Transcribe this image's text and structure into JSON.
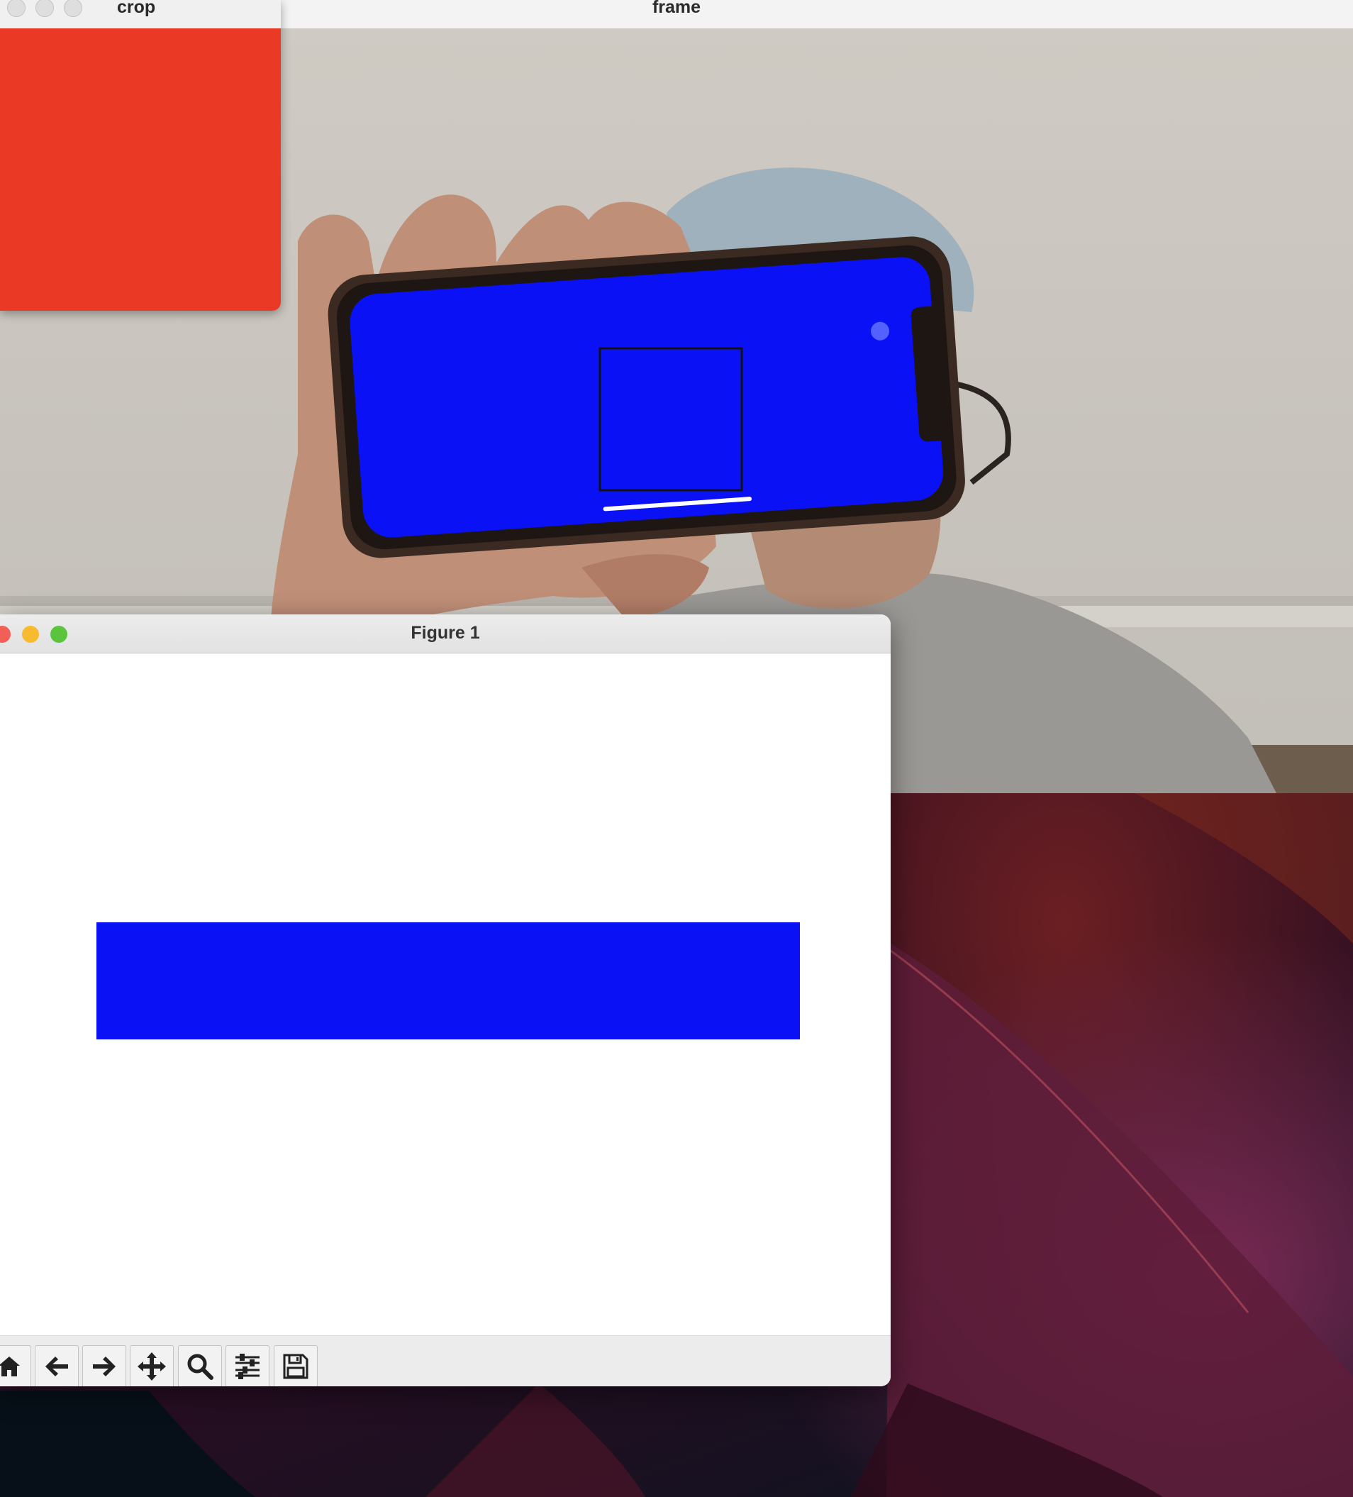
{
  "frame_window": {
    "title": "frame"
  },
  "crop_window": {
    "title": "crop",
    "fill_color": "#ea3a26"
  },
  "figure_window": {
    "title": "Figure 1",
    "bar_color": "#0a12f5",
    "toolbar": [
      {
        "name": "home-button",
        "icon": "home-icon"
      },
      {
        "name": "back-button",
        "icon": "arrow-left-icon"
      },
      {
        "name": "forward-button",
        "icon": "arrow-right-icon"
      },
      {
        "name": "pan-button",
        "icon": "move-icon"
      },
      {
        "name": "zoom-button",
        "icon": "magnifier-icon"
      },
      {
        "name": "configure-subplots-button",
        "icon": "sliders-icon"
      },
      {
        "name": "save-button",
        "icon": "floppy-disk-icon"
      }
    ]
  },
  "colors": {
    "phone_screen": "#0a12f5",
    "traffic_red": "#f25f57",
    "traffic_yellow": "#f8bb30",
    "traffic_green": "#5ac53c"
  }
}
